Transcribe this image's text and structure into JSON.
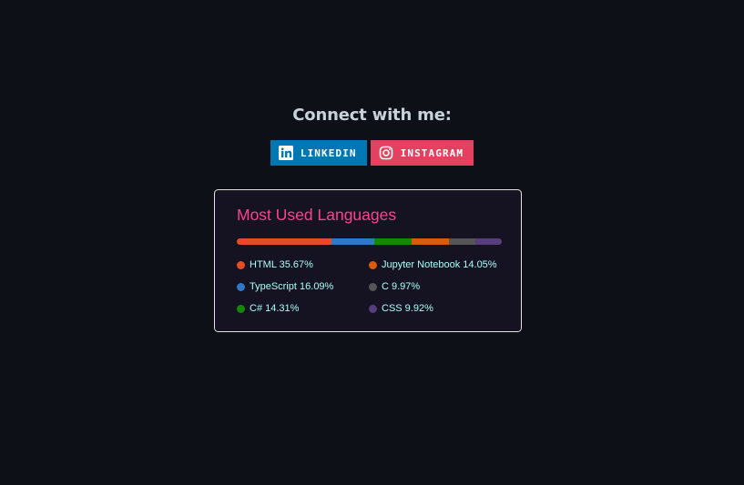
{
  "connect": {
    "heading": "Connect with me:"
  },
  "badges": [
    {
      "label": "LINKEDIN",
      "icon": "linkedin-icon",
      "color": "#0077b5"
    },
    {
      "label": "INSTAGRAM",
      "icon": "instagram-icon",
      "color": "#e4405f"
    }
  ],
  "languages_card": {
    "title": "Most Used Languages",
    "title_color": "#fe428e",
    "text_color": "#a9fef7",
    "border_color": "#e4e2e2",
    "background": "#151321",
    "languages": [
      {
        "name": "HTML",
        "percent": 35.67,
        "label": "HTML 35.67%",
        "color": "#e34c26"
      },
      {
        "name": "TypeScript",
        "percent": 16.09,
        "label": "TypeScript 16.09%",
        "color": "#3178c6"
      },
      {
        "name": "C#",
        "percent": 14.31,
        "label": "C# 14.31%",
        "color": "#178600"
      },
      {
        "name": "Jupyter Notebook",
        "percent": 14.05,
        "label": "Jupyter Notebook 14.05%",
        "color": "#da5b0b"
      },
      {
        "name": "C",
        "percent": 9.97,
        "label": "C 9.97%",
        "color": "#555555"
      },
      {
        "name": "CSS",
        "percent": 9.92,
        "label": "CSS 9.92%",
        "color": "#563d7c"
      }
    ],
    "legend_order_left": [
      0,
      1,
      2
    ],
    "legend_order_right": [
      3,
      4,
      5
    ]
  }
}
